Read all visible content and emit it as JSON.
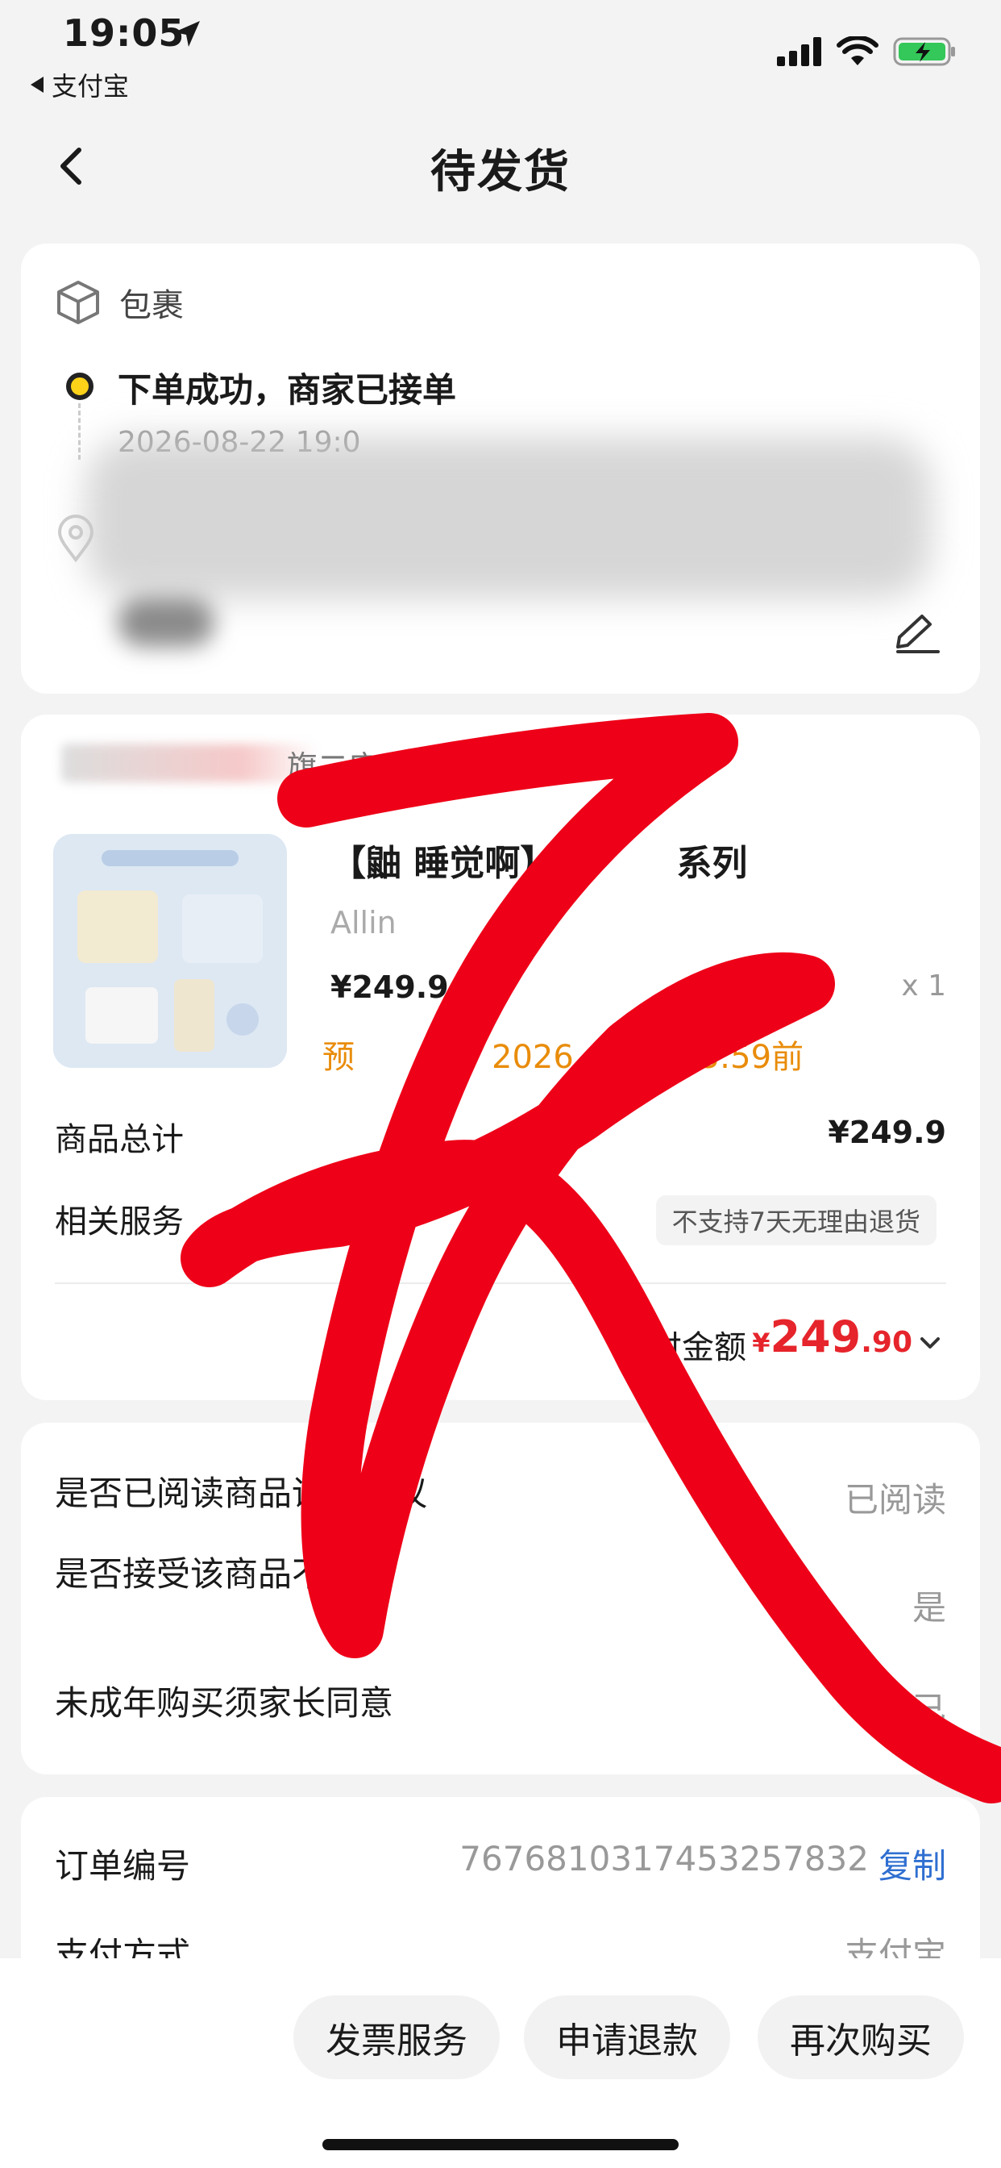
{
  "status_bar": {
    "time": "19:05",
    "back_app": "支付宝"
  },
  "nav": {
    "title": "待发货"
  },
  "package": {
    "header": "包裹",
    "status": "下单成功，商家已接单",
    "time": "2026-08-22 19:0"
  },
  "product": {
    "shop_name_tail": "旗二店",
    "title": "【鼬 睡觉啊】",
    "title_tail": "系列",
    "sku": "Allin",
    "price": "¥249.9",
    "qty": "x 1",
    "ship_prefix": "预",
    "ship_mid": "货",
    "ship_year": "2026",
    "ship_time": "23:59前",
    "total_label": "商品总计",
    "total_value": "¥249.9",
    "service_label": "相关服务",
    "service_tag": "不支持7天无理由退货",
    "paid_label": "付金额",
    "paid_currency": "¥",
    "paid_int": "249",
    "paid_dec": ".90"
  },
  "agreements": {
    "items": [
      {
        "label": "是否已阅读商品详情协议",
        "value": "已阅读"
      },
      {
        "label": "是否接受该商品不退款",
        "value": "是"
      },
      {
        "label": "未成年购买须家长同意",
        "value": "我已"
      }
    ]
  },
  "order": {
    "number_label": "订单编号",
    "number_value": "7676810317453257832",
    "copy_label": "复制",
    "pay_label": "支付方式",
    "pay_value": "支付宝"
  },
  "actions": {
    "invoice": "发票服务",
    "refund": "申请退款",
    "rebuy": "再次购买"
  },
  "colors": {
    "accent_red": "#e6242b",
    "ship_orange": "#e98c0a",
    "link_blue": "#2f6fd1",
    "dot_yellow": "#ffd21a",
    "scribble_red": "#ee0018"
  }
}
